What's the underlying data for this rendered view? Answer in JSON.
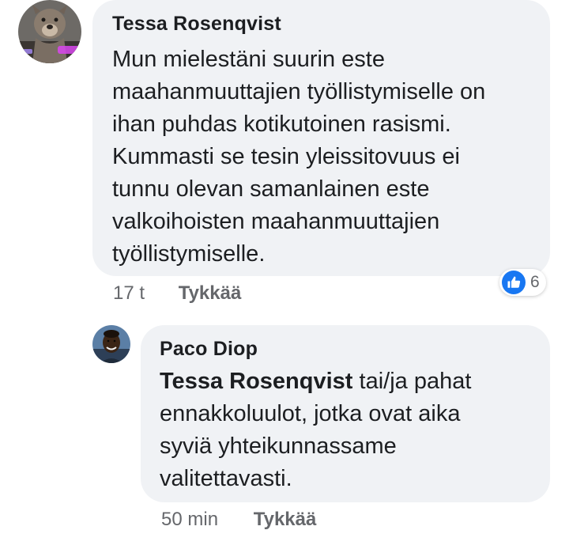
{
  "comments": [
    {
      "author": "Tessa Rosenqvist",
      "text": "Mun mielestäni suurin este\nmaahanmuuttajien työllistymiselle on\nihan puhdas kotikutoinen rasismi.\nKummasti se tesin yleissitovuus ei\ntunnu olevan samanlainen este\nvalkoihoisten maahanmuuttajien\ntyöllistymiselle.",
      "avatar_icon": "dog-photo-avatar",
      "time": "17 t",
      "like_label": "Tykkää",
      "reaction_icon": "thumbs-up-icon",
      "reaction_count": "6"
    },
    {
      "author": "Paco Diop",
      "mention": "Tessa Rosenqvist",
      "text": " tai/ja pahat\nennakkoluulot, jotka ovat aika\nsyviä yhteikunnassame\nvalitettavasti.",
      "avatar_icon": "person-photo-avatar",
      "time": "50 min",
      "like_label": "Tykkää"
    }
  ],
  "colors": {
    "bubble": "#f0f2f5",
    "text": "#1c1e21",
    "meta": "#65676b",
    "like_blue": "#1877f2"
  }
}
